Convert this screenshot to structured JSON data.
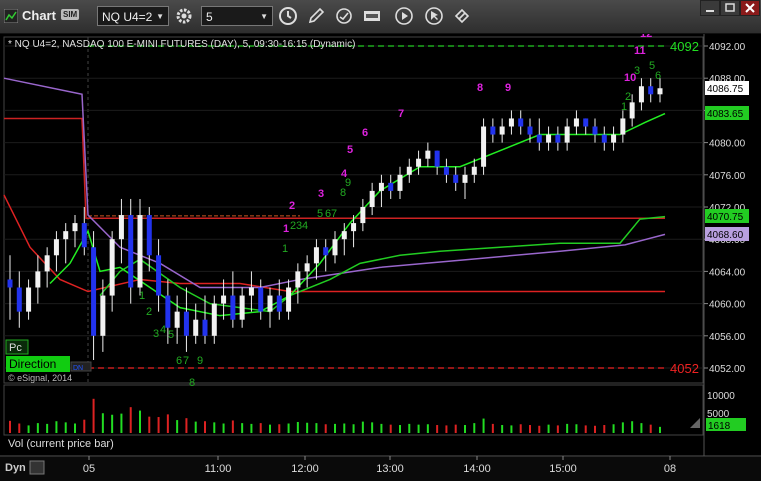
{
  "window": {
    "title": "Chart",
    "badge": "SIM",
    "symbol": "NQ U4=2",
    "interval": "5"
  },
  "chart_info": {
    "header": "* NQ U4=2, NASDAQ 100 E-MINI FUTURES (DAY), 5, 09:30-16:15 (Dynamic)",
    "copyright": "© eSignal, 2014",
    "pc_label": "Pc",
    "direction_label": "Direction",
    "direction_tag": "DN",
    "volume_label": "Vol (current price bar)",
    "dyn_label": "Dyn"
  },
  "price_axis": {
    "ticks": [
      "4092.00",
      "4088.00",
      "4084.00",
      "4080.00",
      "4076.00",
      "4072.00",
      "4068.00",
      "4064.00",
      "4060.00",
      "4056.00",
      "4052.00"
    ],
    "markers": [
      {
        "label": "4086.75",
        "bg": "#ffffff",
        "fg": "#000000"
      },
      {
        "label": "4083.65",
        "bg": "#22cc22",
        "fg": "#000000"
      },
      {
        "label": "4070.75",
        "bg": "#22cc22",
        "fg": "#000000"
      },
      {
        "label": "4068.60",
        "bg": "#b9a0e0",
        "fg": "#000000"
      }
    ],
    "line_labels": [
      {
        "label": "4092",
        "color": "#22dd22"
      },
      {
        "label": "4052",
        "color": "#ee2222"
      }
    ]
  },
  "volume_axis": {
    "ticks": [
      "10000",
      "5000"
    ],
    "marker": "1618"
  },
  "time_axis": {
    "ticks": [
      "05",
      "11:00",
      "12:00",
      "13:00",
      "14:00",
      "15:00",
      "08"
    ]
  },
  "counts": [
    {
      "t": "1",
      "c": "#dd22dd"
    },
    {
      "t": "2",
      "c": "#dd22dd"
    },
    {
      "t": "3",
      "c": "#dd22dd"
    },
    {
      "t": "4",
      "c": "#dd22dd"
    },
    {
      "t": "5",
      "c": "#dd22dd"
    },
    {
      "t": "6",
      "c": "#dd22dd"
    },
    {
      "t": "7",
      "c": "#dd22dd"
    },
    {
      "t": "8",
      "c": "#dd22dd"
    },
    {
      "t": "9",
      "c": "#dd22dd"
    },
    {
      "t": "10",
      "c": "#dd22dd"
    },
    {
      "t": "11",
      "c": "#dd22dd"
    },
    {
      "t": "12",
      "c": "#dd22dd"
    },
    {
      "t": "1",
      "c": "#22aa22"
    },
    {
      "t": "2",
      "c": "#22aa22"
    },
    {
      "t": "3",
      "c": "#22aa22"
    },
    {
      "t": "4",
      "c": "#22aa22"
    },
    {
      "t": "5",
      "c": "#22aa22"
    },
    {
      "t": "6",
      "c": "#22aa22"
    },
    {
      "t": "7",
      "c": "#22aa22"
    },
    {
      "t": "8",
      "c": "#22aa22"
    },
    {
      "t": "9",
      "c": "#22aa22"
    },
    {
      "t": "1",
      "c": "#22aa22"
    },
    {
      "t": "2",
      "c": "#22aa22"
    },
    {
      "t": "3",
      "c": "#22aa22"
    },
    {
      "t": "4",
      "c": "#22aa22"
    },
    {
      "t": "5",
      "c": "#22aa22"
    },
    {
      "t": "6",
      "c": "#22aa22"
    },
    {
      "t": "7",
      "c": "#22aa22"
    },
    {
      "t": "8",
      "c": "#22aa22"
    },
    {
      "t": "9",
      "c": "#22aa22"
    },
    {
      "t": "1",
      "c": "#22aa22"
    },
    {
      "t": "2",
      "c": "#22aa22"
    },
    {
      "t": "3",
      "c": "#22aa22"
    },
    {
      "t": "5",
      "c": "#22aa22"
    },
    {
      "t": "6",
      "c": "#22aa22"
    }
  ],
  "candles": [
    [
      4063,
      4066,
      4058,
      4062
    ],
    [
      4062,
      4064,
      4057,
      4059
    ],
    [
      4059,
      4063,
      4058,
      4062
    ],
    [
      4062,
      4066,
      4060,
      4064
    ],
    [
      4064,
      4067,
      4062,
      4066
    ],
    [
      4066,
      4069,
      4064,
      4068
    ],
    [
      4068,
      4070,
      4065,
      4069
    ],
    [
      4069,
      4071,
      4067,
      4070
    ],
    [
      4070,
      4072,
      4066,
      4067
    ],
    [
      4067,
      4069,
      4053,
      4056
    ],
    [
      4056,
      4063,
      4054,
      4061
    ],
    [
      4061,
      4069,
      4059,
      4068
    ],
    [
      4068,
      4073,
      4065,
      4071
    ],
    [
      4071,
      4073,
      4060,
      4062
    ],
    [
      4062,
      4073,
      4061,
      4071
    ],
    [
      4071,
      4072,
      4064,
      4066
    ],
    [
      4066,
      4068,
      4059,
      4061
    ],
    [
      4061,
      4063,
      4055,
      4057
    ],
    [
      4057,
      4061,
      4055,
      4059
    ],
    [
      4059,
      4062,
      4054,
      4056
    ],
    [
      4056,
      4060,
      4055,
      4058
    ],
    [
      4058,
      4061,
      4055,
      4056
    ],
    [
      4056,
      4061,
      4055,
      4060
    ],
    [
      4060,
      4063,
      4058,
      4061
    ],
    [
      4061,
      4064,
      4057,
      4058
    ],
    [
      4058,
      4062,
      4057,
      4061
    ],
    [
      4061,
      4064,
      4059,
      4062
    ],
    [
      4062,
      4063,
      4058,
      4059
    ],
    [
      4059,
      4062,
      4057,
      4061
    ],
    [
      4061,
      4063,
      4058,
      4059
    ],
    [
      4059,
      4063,
      4058,
      4062
    ],
    [
      4062,
      4065,
      4060,
      4064
    ],
    [
      4064,
      4066,
      4062,
      4065
    ],
    [
      4065,
      4068,
      4063,
      4067
    ],
    [
      4067,
      4068,
      4064,
      4066
    ],
    [
      4066,
      4069,
      4065,
      4068
    ],
    [
      4068,
      4070,
      4066,
      4069
    ],
    [
      4069,
      4071,
      4067,
      4070
    ],
    [
      4070,
      4073,
      4069,
      4072
    ],
    [
      4072,
      4075,
      4071,
      4074
    ],
    [
      4074,
      4076,
      4072,
      4075
    ],
    [
      4075,
      4076,
      4073,
      4074
    ],
    [
      4074,
      4077,
      4073,
      4076
    ],
    [
      4076,
      4078,
      4075,
      4077
    ],
    [
      4077,
      4079,
      4076,
      4078
    ],
    [
      4078,
      4080,
      4077,
      4079
    ],
    [
      4079,
      4079,
      4076,
      4077
    ],
    [
      4077,
      4078,
      4075,
      4076
    ],
    [
      4076,
      4077,
      4074,
      4075
    ],
    [
      4075,
      4077,
      4073,
      4076
    ],
    [
      4076,
      4078,
      4075,
      4077
    ],
    [
      4077,
      4083,
      4076,
      4082
    ],
    [
      4082,
      4083,
      4080,
      4081
    ],
    [
      4081,
      4083,
      4080,
      4082
    ],
    [
      4082,
      4084,
      4081,
      4083
    ],
    [
      4083,
      4084,
      4081,
      4082
    ],
    [
      4082,
      4083,
      4080,
      4081
    ],
    [
      4081,
      4083,
      4079,
      4080
    ],
    [
      4080,
      4082,
      4079,
      4081
    ],
    [
      4081,
      4082,
      4079,
      4080
    ],
    [
      4080,
      4083,
      4079,
      4082
    ],
    [
      4082,
      4084,
      4081,
      4083
    ],
    [
      4083,
      4083,
      4081,
      4082
    ],
    [
      4082,
      4083,
      4080,
      4081
    ],
    [
      4081,
      4082,
      4079,
      4080
    ],
    [
      4080,
      4082,
      4079,
      4081
    ],
    [
      4081,
      4084,
      4080,
      4083
    ],
    [
      4083,
      4086,
      4082,
      4085
    ],
    [
      4085,
      4088,
      4084,
      4087
    ],
    [
      4087,
      4088,
      4085,
      4086
    ],
    [
      4086,
      4088,
      4085,
      4086.75
    ]
  ],
  "volumes": [
    3200,
    2500,
    2000,
    2600,
    2400,
    3100,
    2800,
    2500,
    3500,
    9000,
    5200,
    4800,
    5100,
    6800,
    5900,
    4300,
    4200,
    4900,
    3400,
    3900,
    3000,
    3100,
    2800,
    2500,
    3300,
    2600,
    2400,
    2600,
    2200,
    2300,
    2500,
    2900,
    2700,
    2600,
    2300,
    2400,
    2500,
    2300,
    3000,
    2800,
    2400,
    2200,
    2100,
    2400,
    2200,
    2300,
    2100,
    2000,
    2200,
    2100,
    2600,
    3800,
    2400,
    2100,
    2000,
    2300,
    2100,
    1900,
    2200,
    2000,
    2400,
    2300,
    2000,
    1900,
    2100,
    2300,
    2800,
    3100,
    2600,
    2200,
    1618
  ]
}
